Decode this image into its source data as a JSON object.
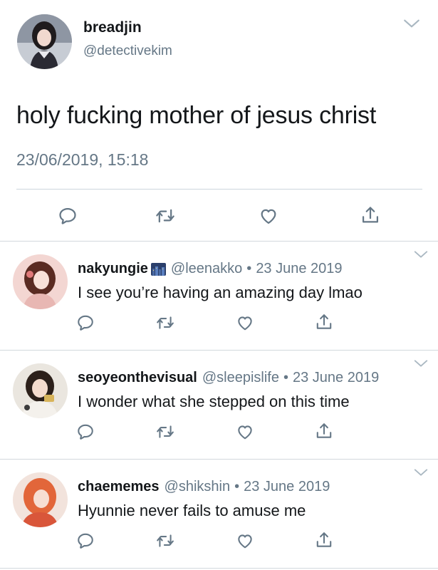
{
  "main_tweet": {
    "display_name": "breadjin",
    "handle": "@detectivekim",
    "text": "holy fucking mother of jesus christ",
    "timestamp": "23/06/2019, 15:18",
    "avatar_icon": "profile-photo",
    "actions": [
      "reply-icon",
      "retweet-icon",
      "like-icon",
      "share-icon"
    ]
  },
  "replies": [
    {
      "display_name": "nakyungie",
      "emoji": "city-night-emoji",
      "handle": "@leenakko",
      "separator": "•",
      "date": "23 June 2019",
      "text": "I see you’re having an amazing day lmao"
    },
    {
      "display_name": "seoyeonthevisual",
      "handle": "@sleepislife",
      "separator": "•",
      "date": "23 June 2019",
      "text": "I wonder what she stepped on this time"
    },
    {
      "display_name": "chaememes",
      "handle": "@shikshin",
      "separator": "•",
      "date": "23 June 2019",
      "text": "Hyunnie never fails to amuse me"
    }
  ],
  "colors": {
    "text_primary": "#14171a",
    "text_secondary": "#657786",
    "icon": "#657786",
    "divider": "#ccd6dd"
  }
}
